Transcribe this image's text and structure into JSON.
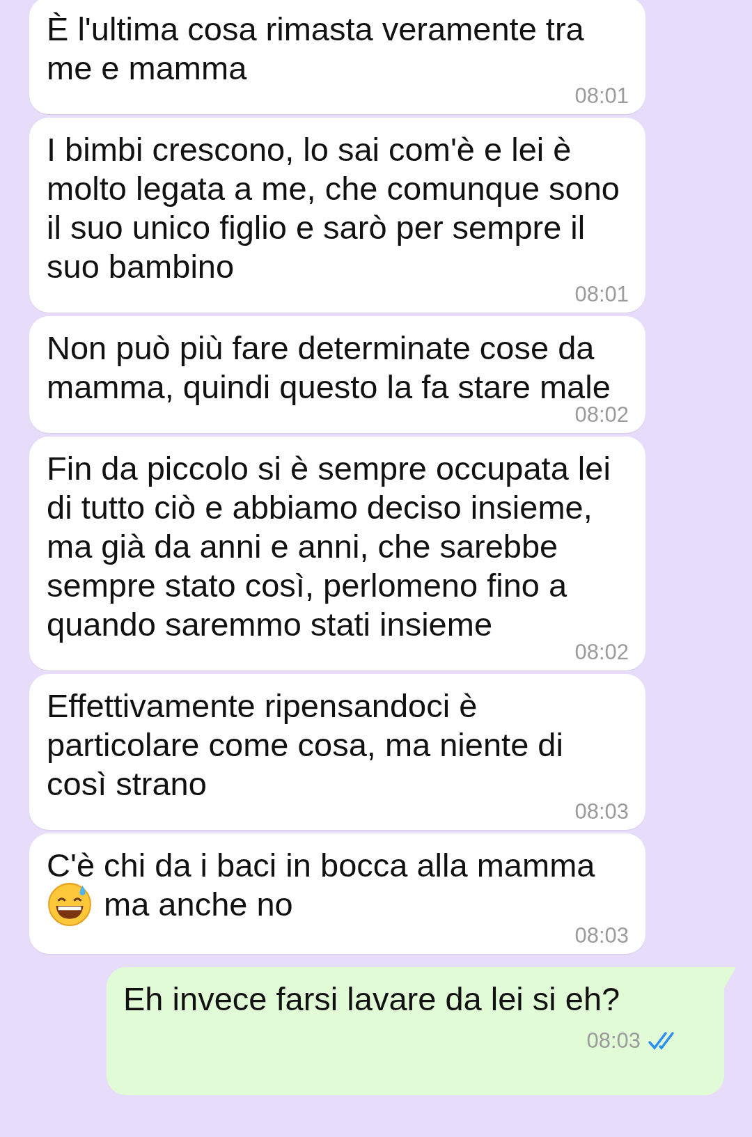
{
  "messages": [
    {
      "kind": "received",
      "text": "È l'ultima cosa rimasta veramente tra me e mamma",
      "time": "08:01"
    },
    {
      "kind": "received",
      "text": "I bimbi crescono, lo sai com'è e lei è molto legata a me, che comunque sono il suo unico figlio e sarò per sempre il suo bambino",
      "time": "08:01"
    },
    {
      "kind": "received",
      "text": "Non può più fare determinate cose da mamma, quindi questo la fa stare male",
      "time": "08:02"
    },
    {
      "kind": "received",
      "text": "Fin da piccolo si è sempre occupata lei di tutto ciò e abbiamo deciso insieme, ma già da anni e anni, che sarebbe sempre stato così, perlomeno fino a quando saremmo stati insieme",
      "time": "08:02"
    },
    {
      "kind": "received",
      "text": "Effettivamente ripensandoci è particolare come cosa, ma niente di così strano",
      "time": "08:03"
    },
    {
      "kind": "received",
      "text": "C'è chi da i baci in bocca alla mamma",
      "emoji": true,
      "text_after": "ma anche no",
      "time": "08:03"
    },
    {
      "kind": "sent",
      "text": "Eh invece farsi lavare da lei si eh?",
      "time": "08:03",
      "read": true
    }
  ]
}
